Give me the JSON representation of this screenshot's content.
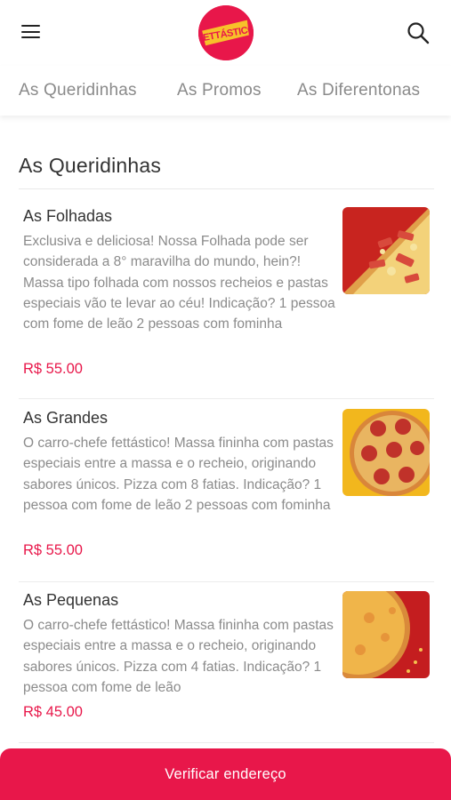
{
  "header": {
    "brand_logo_text": "FETTÁSTICO",
    "icons": {
      "menu": "hamburger-menu-icon",
      "search": "search-icon"
    }
  },
  "tabs": [
    {
      "label": "As Queridinhas"
    },
    {
      "label": "As Promos"
    },
    {
      "label": "As Diferentonas"
    }
  ],
  "section": {
    "title": "As Queridinhas",
    "items": [
      {
        "name": "As Folhadas",
        "description": "Exclusiva e deliciosa! Nossa Folhada pode ser considerada a 8° maravilha do mundo, hein?! Massa tipo folhada com nossos recheios e pastas especiais vão te levar ao céu! Indicação? 1 pessoa com fome de leão 2 pessoas com fominha",
        "price": "R$ 55.00"
      },
      {
        "name": "As Grandes",
        "description": "O carro-chefe fettástico! Massa fininha com pastas especiais entre a massa e o recheio, originando sabores únicos. Pizza com 8 fatias. Indicação? 1 pessoa com fome de leão 2 pessoas com fominha",
        "price": "R$ 55.00"
      },
      {
        "name": "As Pequenas",
        "description": "O carro-chefe fettástico! Massa fininha com pastas especiais entre a massa e o recheio, originando sabores únicos. Pizza com 4 fatias. Indicação? 1 pessoa com fome de leão",
        "price": "R$ 45.00"
      }
    ]
  },
  "cta": {
    "label": "Verificar endereço"
  },
  "colors": {
    "accent": "#e8174a",
    "logo_text": "#f7c12a",
    "text_primary": "#333333",
    "text_secondary": "#8b8b8b"
  }
}
